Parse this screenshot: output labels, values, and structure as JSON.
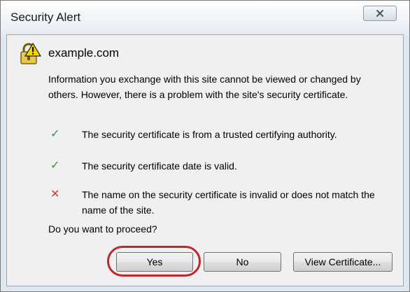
{
  "window": {
    "title": "Security Alert",
    "close_icon": "close-icon"
  },
  "alert": {
    "icon": "lock-warning-icon",
    "site": "example.com",
    "message": "Information you exchange with this site cannot be viewed or changed by others. However, there is a problem with the site's security certificate.",
    "checks": [
      {
        "status": "ok",
        "icon": "check-icon",
        "color": "#2f9a3a",
        "text": "The security certificate is from a trusted certifying authority."
      },
      {
        "status": "ok",
        "icon": "check-icon",
        "color": "#2f9a3a",
        "text": "The security certificate date is valid."
      },
      {
        "status": "error",
        "icon": "error-x-icon",
        "color": "#d23a2c",
        "text": "The name on the security certificate is invalid or does not match the name of the site."
      }
    ],
    "question": "Do you want to proceed?"
  },
  "buttons": {
    "yes": "Yes",
    "no": "No",
    "view_certificate": "View Certificate..."
  },
  "highlight": {
    "target": "yes-button",
    "color": "#c0282d"
  }
}
